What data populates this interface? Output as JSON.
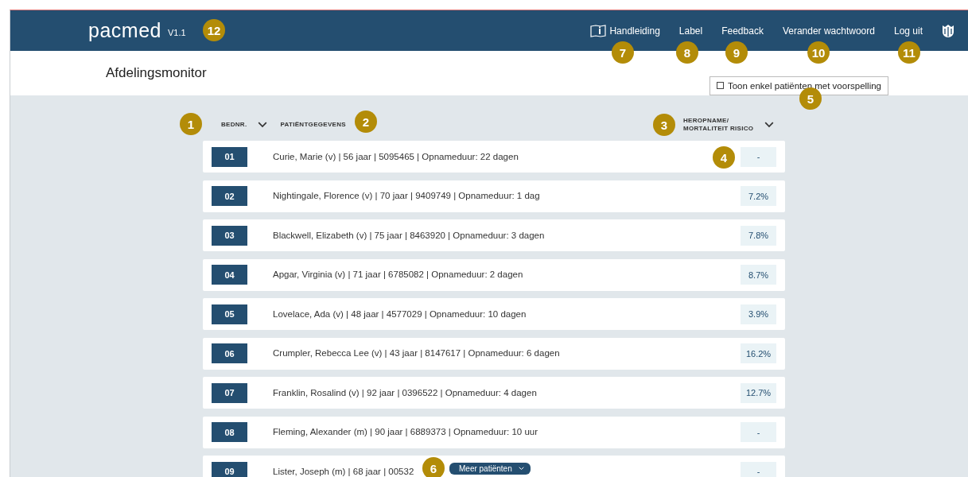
{
  "header": {
    "logo": "pacmed",
    "version": "V1.1",
    "nav": [
      {
        "label": "Handleiding"
      },
      {
        "label": "Label"
      },
      {
        "label": "Feedback"
      },
      {
        "label": "Verander wachtwoord"
      },
      {
        "label": "Log uit"
      }
    ]
  },
  "page_title": "Afdelingsmonitor",
  "filter": {
    "label": "Toon enkel patiënten met voorspelling",
    "checked": false
  },
  "columns": [
    {
      "label": "BEDNR.",
      "sortable": true
    },
    {
      "label": "PATIËNTGEGEVENS",
      "sortable": false
    },
    {
      "label": "HEROPNAME/ MORTALITEIT RISICO",
      "sortable": true
    }
  ],
  "patients": [
    {
      "bed": "01",
      "info": "Curie, Marie (v) | 56 jaar | 5095465 | Opnameduur: 22 dagen",
      "risk": "-"
    },
    {
      "bed": "02",
      "info": "Nightingale, Florence (v) | 70 jaar | 9409749 | Opnameduur: 1 dag",
      "risk": "7.2%"
    },
    {
      "bed": "03",
      "info": "Blackwell, Elizabeth (v) | 75 jaar | 8463920 | Opnameduur: 3 dagen",
      "risk": "7.8%"
    },
    {
      "bed": "04",
      "info": "Apgar, Virginia (v) | 71 jaar | 6785082 | Opnameduur: 2 dagen",
      "risk": "8.7%"
    },
    {
      "bed": "05",
      "info": "Lovelace, Ada (v) | 48 jaar | 4577029 | Opnameduur: 10 dagen",
      "risk": "3.9%"
    },
    {
      "bed": "06",
      "info": "Crumpler, Rebecca Lee (v) | 43 jaar | 8147617 | Opnameduur: 6 dagen",
      "risk": "16.2%"
    },
    {
      "bed": "07",
      "info": "Franklin, Rosalind (v) | 92 jaar | 0396522 | Opnameduur: 4 dagen",
      "risk": "12.7%"
    },
    {
      "bed": "08",
      "info": "Fleming, Alexander (m) | 90 jaar | 6889373 | Opnameduur: 10 uur",
      "risk": "-"
    },
    {
      "bed": "09",
      "info": "Lister, Joseph (m) | 68 jaar | 00532",
      "risk": "-"
    }
  ],
  "more_button": {
    "label": "Meer patiënten"
  },
  "annotations": [
    "12",
    "7",
    "8",
    "9",
    "10",
    "11",
    "5",
    "1",
    "2",
    "3",
    "4",
    "6"
  ]
}
